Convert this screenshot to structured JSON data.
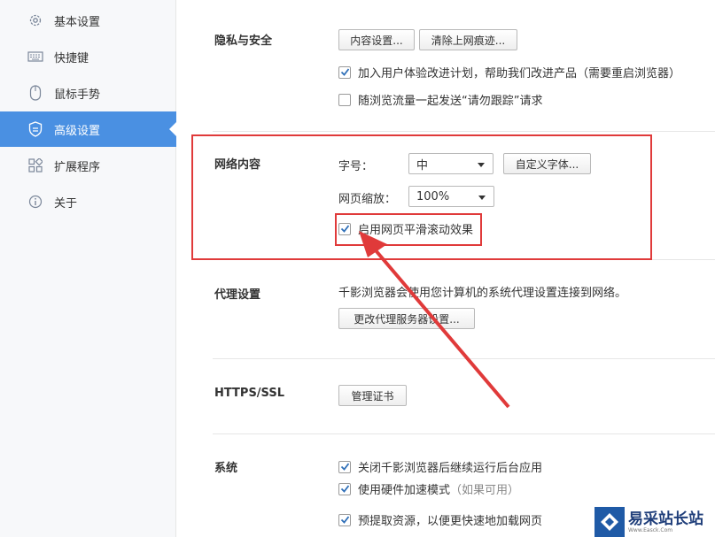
{
  "sidebar": {
    "items": [
      {
        "label": "基本设置",
        "icon": "gear-icon"
      },
      {
        "label": "快捷键",
        "icon": "keyboard-icon"
      },
      {
        "label": "鼠标手势",
        "icon": "mouse-icon"
      },
      {
        "label": "高级设置",
        "icon": "shield-icon",
        "active": true
      },
      {
        "label": "扩展程序",
        "icon": "extensions-icon"
      },
      {
        "label": "关于",
        "icon": "info-icon"
      }
    ]
  },
  "privacy": {
    "title": "隐私与安全",
    "content_settings_btn": "内容设置...",
    "clear_history_btn": "清除上网痕迹...",
    "ux_plan": "加入用户体验改进计划，帮助我们改进产品（需要重启浏览器）",
    "dnt": "随浏览流量一起发送“请勿跟踪”请求"
  },
  "web_content": {
    "title": "网络内容",
    "font_size_label": "字号：",
    "font_size_value": "中",
    "custom_fonts_btn": "自定义字体...",
    "zoom_label": "网页缩放：",
    "zoom_value": "100%",
    "smooth_scroll": "启用网页平滑滚动效果"
  },
  "proxy": {
    "title": "代理设置",
    "desc": "千影浏览器会使用您计算机的系统代理设置连接到网络。",
    "change_btn": "更改代理服务器设置..."
  },
  "https": {
    "title": "HTTPS/SSL",
    "manage_certs_btn": "管理证书"
  },
  "system": {
    "title": "系统",
    "bg_apps": "关闭千影浏览器后继续运行后台应用",
    "hw_accel": "使用硬件加速模式",
    "hw_accel_note": "（如果可用）",
    "prefetch": "预提取资源，以便更快速地加载网页"
  },
  "watermark": {
    "text": "易采站长站",
    "sub": "Www.Easck.Com"
  },
  "colors": {
    "accent": "#4a90e2",
    "highlight": "#e03a3a"
  }
}
